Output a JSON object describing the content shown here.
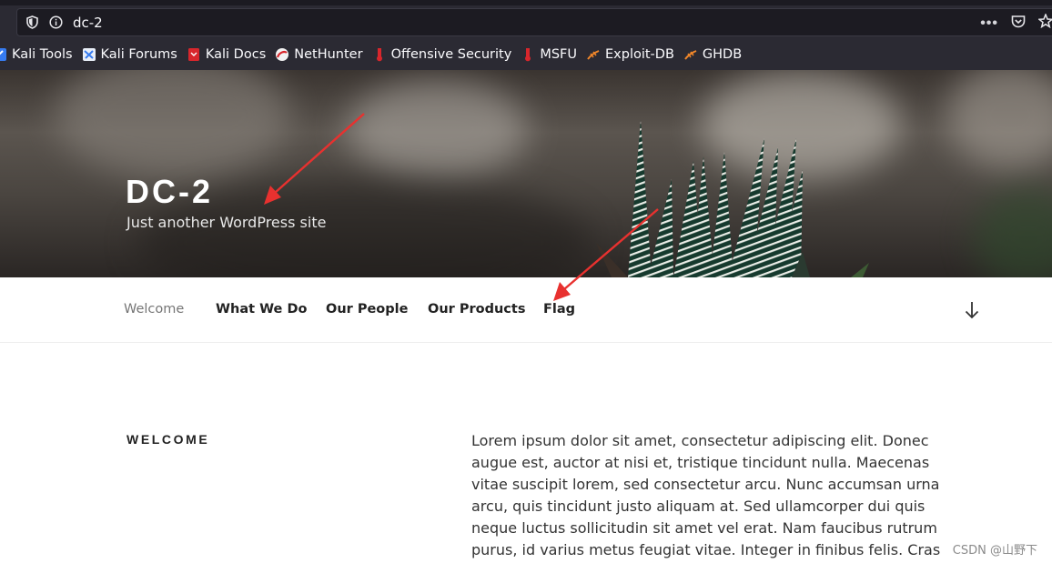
{
  "browser": {
    "url": "dc-2",
    "overflow_menu": "•••",
    "bookmarks": [
      {
        "label": "Kali Tools",
        "icon": "kali-tools-icon"
      },
      {
        "label": "Kali Forums",
        "icon": "kali-forums-icon"
      },
      {
        "label": "Kali Docs",
        "icon": "kali-docs-icon"
      },
      {
        "label": "NetHunter",
        "icon": "nethunter-icon"
      },
      {
        "label": "Offensive Security",
        "icon": "offsec-icon"
      },
      {
        "label": "MSFU",
        "icon": "msfu-icon"
      },
      {
        "label": "Exploit-DB",
        "icon": "exploitdb-icon"
      },
      {
        "label": "GHDB",
        "icon": "ghdb-icon"
      }
    ]
  },
  "site": {
    "title": "DC-2",
    "description": "Just another WordPress site"
  },
  "nav": {
    "items": [
      {
        "label": "Welcome",
        "current": true
      },
      {
        "label": "What We Do",
        "current": false
      },
      {
        "label": "Our People",
        "current": false
      },
      {
        "label": "Our Products",
        "current": false
      },
      {
        "label": "Flag",
        "current": false
      }
    ]
  },
  "content": {
    "section_title": "WELCOME",
    "body": "Lorem ipsum dolor sit amet, consectetur adipiscing elit. Donec augue est, auctor at nisi et, tristique tincidunt nulla. Maecenas vitae suscipit lorem, sed consectetur arcu. Nunc accumsan urna arcu, quis tincidunt justo aliquam at. Sed ullamcorper dui quis neque luctus sollicitudin sit amet vel erat. Nam faucibus rutrum purus, id varius metus feugiat vitae. Integer in finibus felis. Cras a fringilla leo. Sed turpis turpis,"
  },
  "watermark": "CSDN @山野下",
  "colors": {
    "chrome_bg": "#2b2a33",
    "urlbar_bg": "#1c1b22",
    "annotation_arrow": "#e8312f",
    "nav_current": "#767676",
    "nav_text": "#222222"
  }
}
